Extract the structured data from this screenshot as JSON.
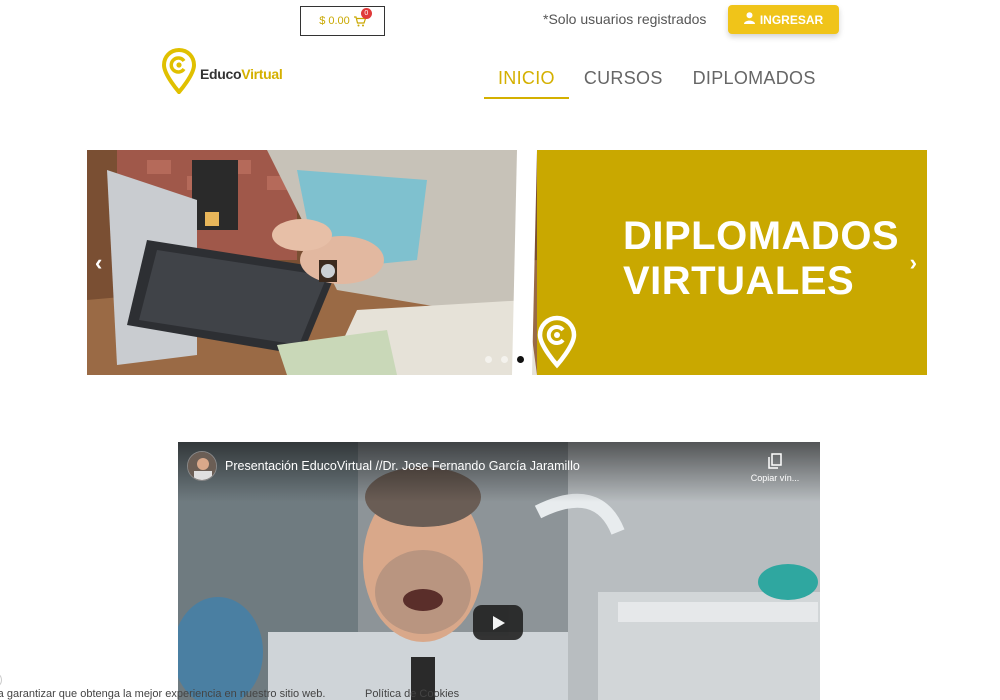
{
  "topbar": {
    "cart_amount": "$ 0.00",
    "cart_count": "0",
    "registered_note": "*Solo usuarios registrados",
    "login_label": "INGRESAR"
  },
  "header": {
    "logo_text_1": "Educo",
    "logo_text_2": "Virtual",
    "nav": [
      {
        "label": "INICIO",
        "active": true
      },
      {
        "label": "CURSOS",
        "active": false
      },
      {
        "label": "DIPLOMADOS",
        "active": false
      }
    ]
  },
  "slider": {
    "line1": "DIPLOMADOS",
    "line2": "VIRTUALES",
    "dot_count": 3,
    "active_dot": 3
  },
  "video": {
    "title": "Presentación EducoVirtual //Dr. Jose Fernando García Jaramillo",
    "copy_label": "Copiar vín..."
  },
  "cookie": {
    "text": "ra garantizar que obtenga la mejor experiencia en nuestro sitio web.",
    "link": "Política de Cookies"
  },
  "colors": {
    "brand_yellow": "#c9a800",
    "accent": "#d4b000",
    "login_button": "#f0c419",
    "cart_badge": "#e03a3a"
  }
}
